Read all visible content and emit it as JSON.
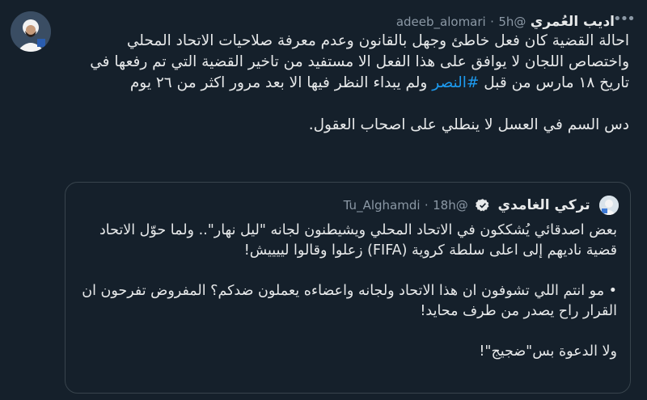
{
  "tweet": {
    "display_name": "اديب العُمري",
    "handle": "@adeeb_alomari",
    "separator": "·",
    "time": "5h",
    "body_line1": "احالة القضية كان فعل خاطئ وجهل بالقانون وعدم معرفة صلاحيات الاتحاد المحلي واختصاص اللجان لا يوافق على هذا الفعل الا مستفيد من تاخير القضية التي تم رفعها في تاريخ ١٨ مارس من قبل",
    "hashtag": "#النصر",
    "body_line1_end": "ولم يبداء النظر فيها الا بعد مرور اكثر من ٢٦ يوم",
    "body_line2": "دس السم في العسل لا ينطلي على اصحاب العقول."
  },
  "quoted": {
    "display_name": "تركي الغامدي",
    "handle": "@Tu_Alghamdi",
    "separator": "·",
    "time": "18h",
    "para1": "بعض اصدقائي يُشككون في الاتحاد المحلي ويشيطنون لجانه \"ليل نهار\".. ولما حوّل الاتحاد قضية ناديهم إلى اعلى سلطة كروية (FIFA) زعلوا وقالوا لييييش!",
    "para2": "• مو انتم اللي تشوفون ان هذا الاتحاد ولجانه واعضاءه يعملون ضدكم؟ المفروض تفرحون ان القرار راح يصدر من طرف محايد!",
    "para3": "ولا الدعوة بس\"ضجيج\"!"
  },
  "icons": {
    "more": "more-horizontal-icon",
    "verified": "verified-badge-icon"
  },
  "colors": {
    "background": "#15202b",
    "text": "#e7e9ea",
    "muted": "#8b98a5",
    "link": "#1d9bf0",
    "border": "#38444d"
  }
}
